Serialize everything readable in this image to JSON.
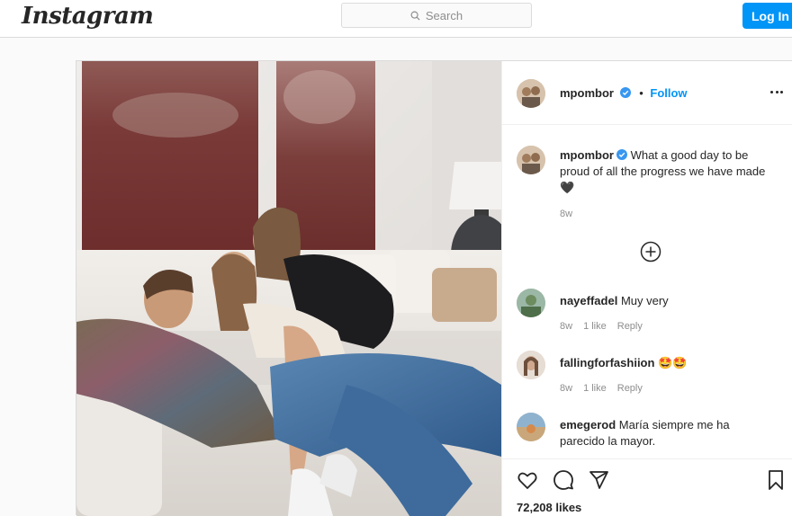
{
  "topbar": {
    "logo_text": "Instagram",
    "search_placeholder": "Search",
    "login_label": "Log In"
  },
  "post": {
    "author": "mpombor",
    "verified": true,
    "follow_label": "Follow",
    "dot": "•",
    "caption_text": "What a good day to be proud of all the progress we have made🖤",
    "caption_time": "8w",
    "likes_text": "72,208 likes"
  },
  "comments": [
    {
      "user": "nayeffadel",
      "text": "Muy very",
      "time": "8w",
      "likes": "1 like",
      "reply": "Reply"
    },
    {
      "user": "fallingforfashiion",
      "text": "🤩🤩",
      "time": "8w",
      "likes": "1 like",
      "reply": "Reply"
    },
    {
      "user": "emegerod",
      "text": "María siempre me ha parecido la mayor.",
      "time": "",
      "likes": "",
      "reply": ""
    }
  ],
  "colors": {
    "accent": "#0095f6",
    "border": "#dbdbdb",
    "muted": "#8e8e8e"
  },
  "icons": [
    "search-icon",
    "verified-icon",
    "more-options-icon",
    "load-more-comments-icon",
    "heart-icon",
    "comment-icon",
    "share-icon",
    "bookmark-icon"
  ]
}
